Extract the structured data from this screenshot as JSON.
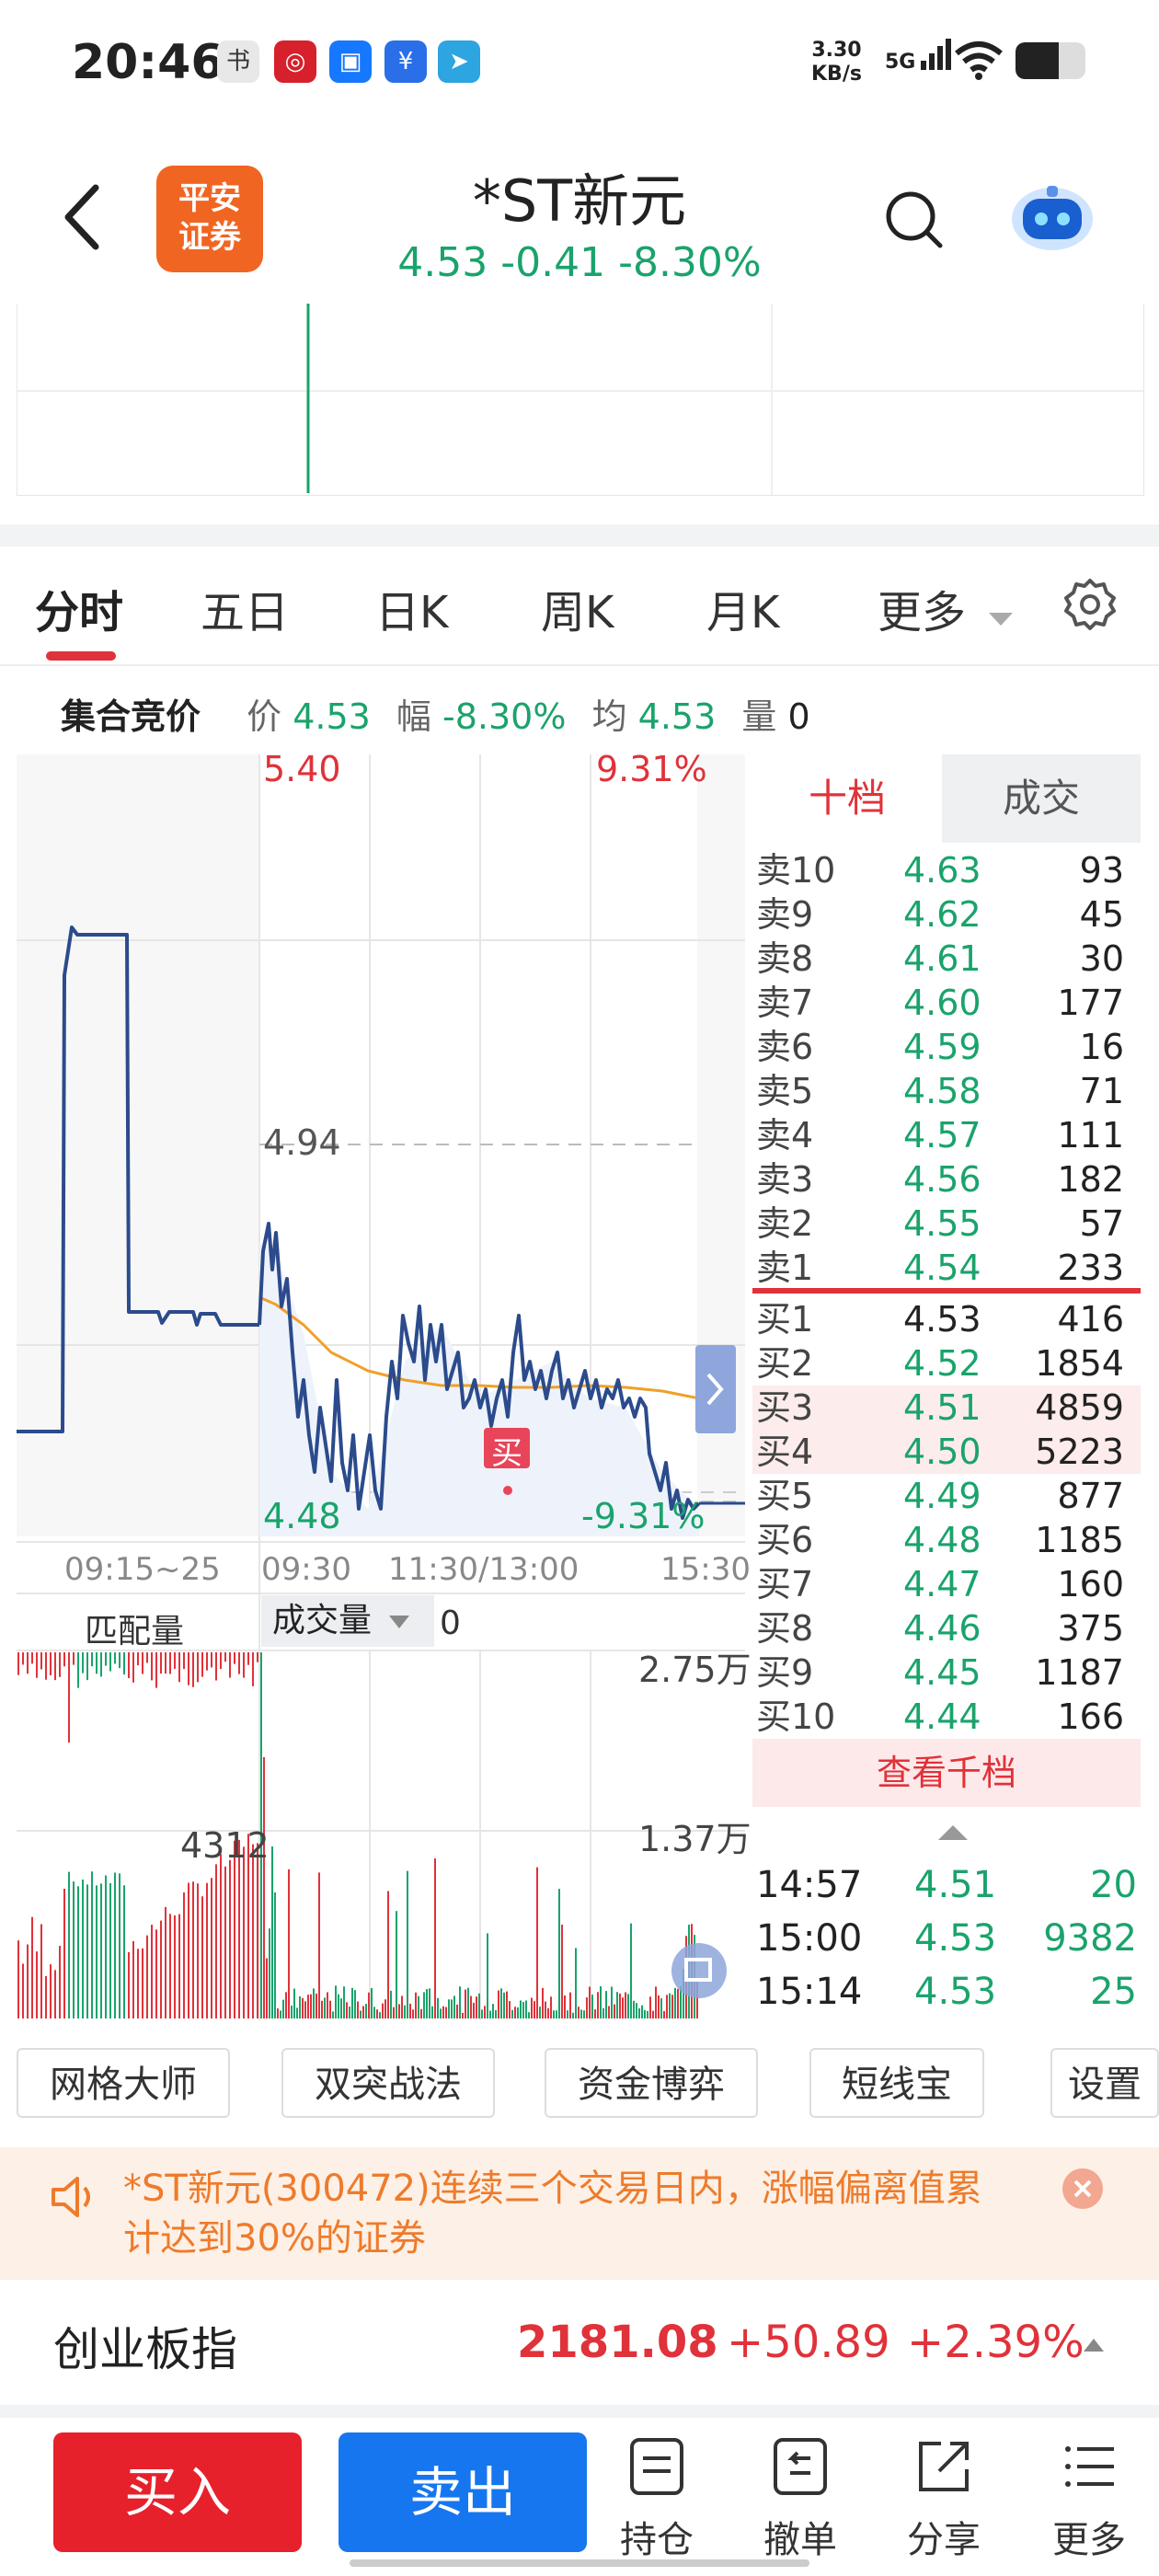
{
  "status_bar": {
    "time": "20:46",
    "net_speed_value": "3.30",
    "net_speed_unit": "KB/s",
    "network": "5G",
    "icons": [
      "reading-app-icon",
      "bank-app-icon",
      "cloud-app-icon",
      "yuan-app-icon",
      "telegram-icon",
      "wifi-icon",
      "battery-icon"
    ]
  },
  "header": {
    "broker_logo_line1": "平安",
    "broker_logo_line2": "证券",
    "stock_name": "*ST新元",
    "price": "4.53",
    "change": "-0.41",
    "change_pct": "-8.30%"
  },
  "tabs": [
    "分时",
    "五日",
    "日K",
    "周K",
    "月K",
    "更多"
  ],
  "auction": {
    "title": "集合竞价",
    "price_label": "价",
    "price": "4.53",
    "range_label": "幅",
    "range": "-8.30%",
    "avg_label": "均",
    "avg": "4.53",
    "volume_label": "量",
    "volume": "0"
  },
  "chart": {
    "high_price": "5.40",
    "high_pct": "9.31%",
    "mid_price": "4.94",
    "low_price": "4.48",
    "low_pct": "-9.31%",
    "buy_marker": "买",
    "time_labels": [
      "09:15~25",
      "09:30",
      "11:30/13:00",
      "15:30"
    ],
    "sub_left_label": "匹配量",
    "sub_select_label": "成交量",
    "sub_value": "0",
    "vol_max": "2.75万",
    "vol_mid": "1.37万",
    "match_value": "4312"
  },
  "order_book": {
    "tab_active": "十档",
    "tab_inactive": "成交",
    "asks": [
      {
        "label": "卖10",
        "price": "4.63",
        "vol": "93"
      },
      {
        "label": "卖9",
        "price": "4.62",
        "vol": "45"
      },
      {
        "label": "卖8",
        "price": "4.61",
        "vol": "30"
      },
      {
        "label": "卖7",
        "price": "4.60",
        "vol": "177"
      },
      {
        "label": "卖6",
        "price": "4.59",
        "vol": "16"
      },
      {
        "label": "卖5",
        "price": "4.58",
        "vol": "71"
      },
      {
        "label": "卖4",
        "price": "4.57",
        "vol": "111"
      },
      {
        "label": "卖3",
        "price": "4.56",
        "vol": "182"
      },
      {
        "label": "卖2",
        "price": "4.55",
        "vol": "57"
      },
      {
        "label": "卖1",
        "price": "4.54",
        "vol": "233"
      }
    ],
    "bids": [
      {
        "label": "买1",
        "price": "4.53",
        "vol": "416"
      },
      {
        "label": "买2",
        "price": "4.52",
        "vol": "1854"
      },
      {
        "label": "买3",
        "price": "4.51",
        "vol": "4859"
      },
      {
        "label": "买4",
        "price": "4.50",
        "vol": "5223"
      },
      {
        "label": "买5",
        "price": "4.49",
        "vol": "877"
      },
      {
        "label": "买6",
        "price": "4.48",
        "vol": "1185"
      },
      {
        "label": "买7",
        "price": "4.47",
        "vol": "160"
      },
      {
        "label": "买8",
        "price": "4.46",
        "vol": "375"
      },
      {
        "label": "买9",
        "price": "4.45",
        "vol": "1187"
      },
      {
        "label": "买10",
        "price": "4.44",
        "vol": "166"
      }
    ],
    "view_more": "查看千档",
    "trades": [
      {
        "time": "14:57",
        "price": "4.51",
        "vol": "20"
      },
      {
        "time": "15:00",
        "price": "4.53",
        "vol": "9382"
      },
      {
        "time": "15:14",
        "price": "4.53",
        "vol": "25"
      }
    ]
  },
  "tools": [
    "网格大师",
    "双突战法",
    "资金博弈",
    "短线宝",
    "设置"
  ],
  "notice": {
    "text": "*ST新元(300472)连续三个交易日内，涨幅偏离值累计达到30%的证券"
  },
  "index_bar": {
    "name": "创业板指",
    "value": "2181.08",
    "change": "+50.89",
    "pct": "+2.39%"
  },
  "bottom_bar": {
    "buy": "买入",
    "sell": "卖出",
    "positions": "持仓",
    "cancel": "撤单",
    "share": "分享",
    "more": "更多"
  },
  "colors": {
    "up_red": "#e0323a",
    "down_green": "#1aa36b",
    "buy_button": "#e6212b",
    "sell_button": "#1676f0",
    "price_line": "#2b4b8c",
    "avg_line": "#f0a02a",
    "notice_bg": "#fdf0e6",
    "notice_text": "#ee7b2b"
  }
}
